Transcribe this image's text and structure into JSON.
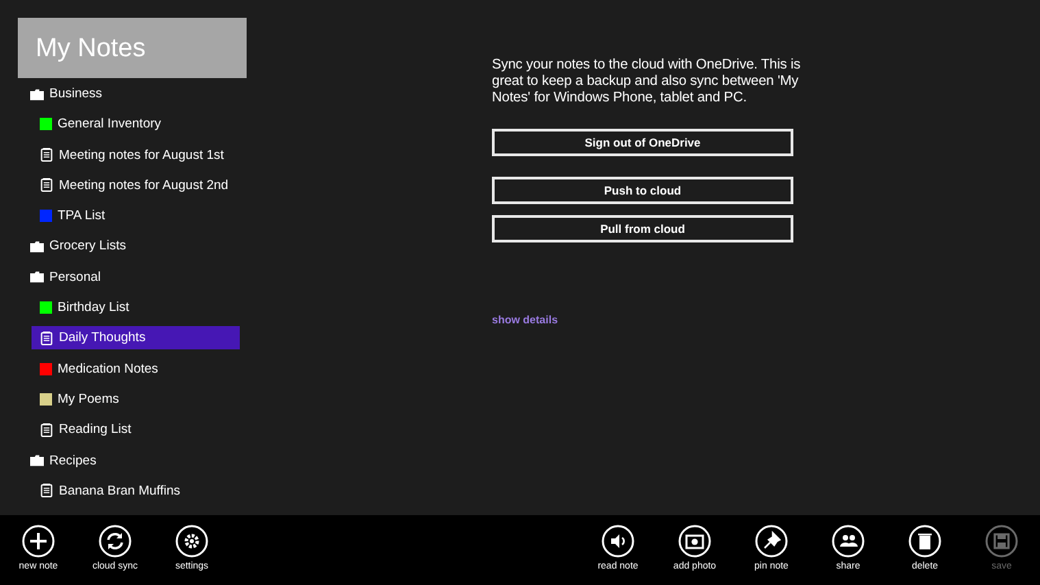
{
  "app_title": "My Notes",
  "tree": [
    {
      "kind": "folder",
      "label": "Business",
      "selected": false,
      "children": [
        {
          "kind": "color",
          "label": "General Inventory",
          "color": "#00ff00",
          "selected": false
        },
        {
          "kind": "note",
          "label": "Meeting notes for August 1st",
          "selected": false
        },
        {
          "kind": "note",
          "label": "Meeting notes for August 2nd",
          "selected": false
        },
        {
          "kind": "color",
          "label": "TPA List",
          "color": "#0026ff",
          "selected": false
        }
      ]
    },
    {
      "kind": "folder",
      "label": "Grocery Lists",
      "selected": false
    },
    {
      "kind": "folder",
      "label": "Personal",
      "selected": false,
      "children": [
        {
          "kind": "color",
          "label": "Birthday List",
          "color": "#00ff00",
          "selected": false
        },
        {
          "kind": "note",
          "label": "Daily Thoughts",
          "selected": true
        },
        {
          "kind": "color",
          "label": "Medication Notes",
          "color": "#ff0000",
          "selected": false
        },
        {
          "kind": "color",
          "label": "My Poems",
          "color": "#d8d08a",
          "selected": false
        },
        {
          "kind": "note",
          "label": "Reading List",
          "selected": false
        }
      ]
    },
    {
      "kind": "folder",
      "label": "Recipes",
      "selected": false,
      "children": [
        {
          "kind": "note",
          "label": "Banana Bran Muffins",
          "selected": false
        }
      ]
    }
  ],
  "sync_panel": {
    "description": "Sync your notes to the cloud with OneDrive.  This is great to keep a backup and also sync between 'My Notes' for Windows Phone, tablet and PC.",
    "account_button": "Sign out of OneDrive",
    "sync_buttons": [
      "Push to cloud",
      "Pull from cloud"
    ],
    "link": "show details"
  },
  "app_bar": {
    "left": [
      {
        "kind": "plus",
        "label": "new note",
        "disabled": false
      },
      {
        "kind": "sync",
        "label": "cloud sync",
        "disabled": false
      },
      {
        "kind": "gear",
        "label": "settings",
        "disabled": false
      }
    ],
    "right": [
      {
        "kind": "speaker",
        "label": "read note",
        "disabled": false
      },
      {
        "kind": "camera",
        "label": "add photo",
        "disabled": false
      },
      {
        "kind": "pin",
        "label": "pin note",
        "disabled": false
      },
      {
        "kind": "people",
        "label": "share",
        "disabled": false
      },
      {
        "kind": "trash",
        "label": "delete",
        "disabled": false
      },
      {
        "kind": "save",
        "label": "save",
        "disabled": true
      }
    ]
  }
}
